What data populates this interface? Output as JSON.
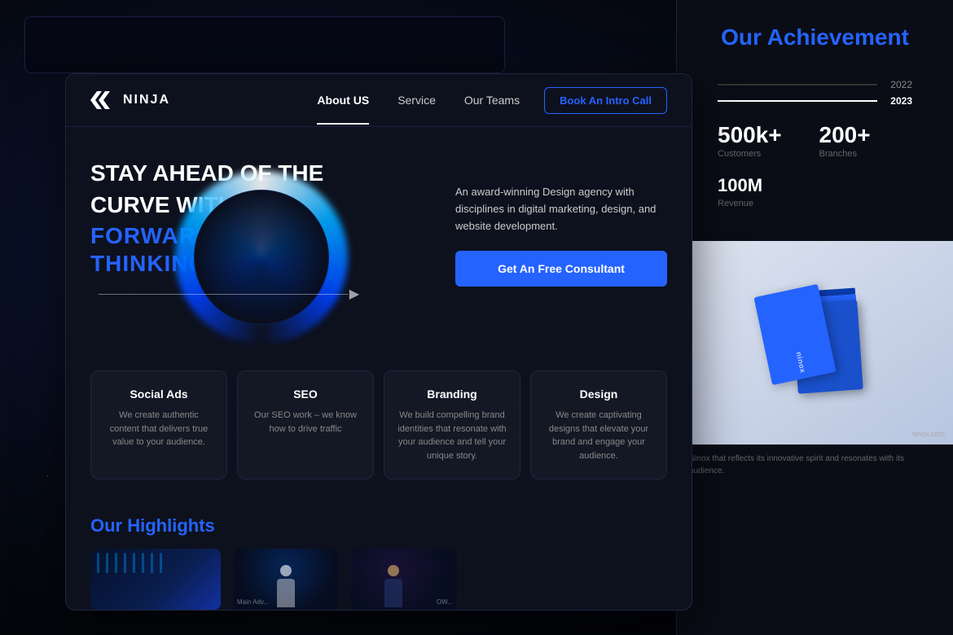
{
  "background": {
    "color": "#0a0e1a"
  },
  "nav": {
    "logo_text": "NINJA",
    "links": [
      {
        "label": "About US",
        "active": true
      },
      {
        "label": "Service",
        "active": false
      },
      {
        "label": "Our Teams",
        "active": false
      }
    ],
    "cta_label": "Book An Intro Call"
  },
  "hero": {
    "headline_line1": "STAY AHEAD OF THE",
    "headline_line2": "CURVE WITH OUR",
    "headline_accent": "FORWARD–THINKING",
    "description": "An award-winning Design agency with disciplines in digital marketing, design, and website development.",
    "cta_label": "Get An Free Consultant"
  },
  "services": [
    {
      "title": "Social Ads",
      "description": "We create authentic content that delivers true value to your audience."
    },
    {
      "title": "SEO",
      "description": "Our SEO work – we know how to drive traffic"
    },
    {
      "title": "Branding",
      "description": "We build compelling brand identities that resonate with your audience and tell your unique story."
    },
    {
      "title": "Design",
      "description": "We create captivating designs that elevate your brand and engage your audience."
    }
  ],
  "highlights": {
    "title_plain": "Our ",
    "title_accent": "Highlights",
    "images": [
      "highlight-1",
      "highlight-2",
      "highlight-3"
    ]
  },
  "achievement": {
    "title_plain": "Our ",
    "title_accent": "Achievement",
    "years": [
      {
        "label": "2022",
        "active": false
      },
      {
        "label": "2023",
        "active": true
      }
    ],
    "stats": [
      {
        "number": "500k+",
        "label": "Customers"
      },
      {
        "number": "200+",
        "label": "Branches"
      },
      {
        "number": "100M",
        "label": "Revenue"
      }
    ],
    "image_caption": "Ninox that reflects its innovative spirit and resonates with its audience."
  }
}
